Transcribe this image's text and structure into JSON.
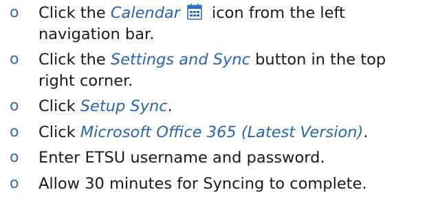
{
  "steps": [
    {
      "bullet": "o",
      "line1_prefix": "Click the ",
      "link": "Calendar",
      "icon": "calendar-icon",
      "line1_suffix": "icon from the left",
      "line2": "navigation bar."
    },
    {
      "bullet": "o",
      "line1_prefix": "Click the ",
      "link": "Settings and Sync",
      "line1_suffix": " button in the top",
      "line2": "right corner."
    },
    {
      "bullet": "o",
      "prefix": "Click ",
      "link": "Setup Sync",
      "suffix": "."
    },
    {
      "bullet": "o",
      "prefix": "Click ",
      "link": "Microsoft Office 365 (Latest Version)",
      "suffix": "."
    },
    {
      "bullet": "o",
      "text": "Enter ETSU username and password."
    },
    {
      "bullet": "o",
      "text": "Allow 30 minutes for Syncing to complete."
    }
  ],
  "colors": {
    "emphasis": "#2565b5",
    "bullet": "#2e6bb8",
    "text": "#1a1a1a",
    "icon_blue": "#2d6fc0"
  }
}
